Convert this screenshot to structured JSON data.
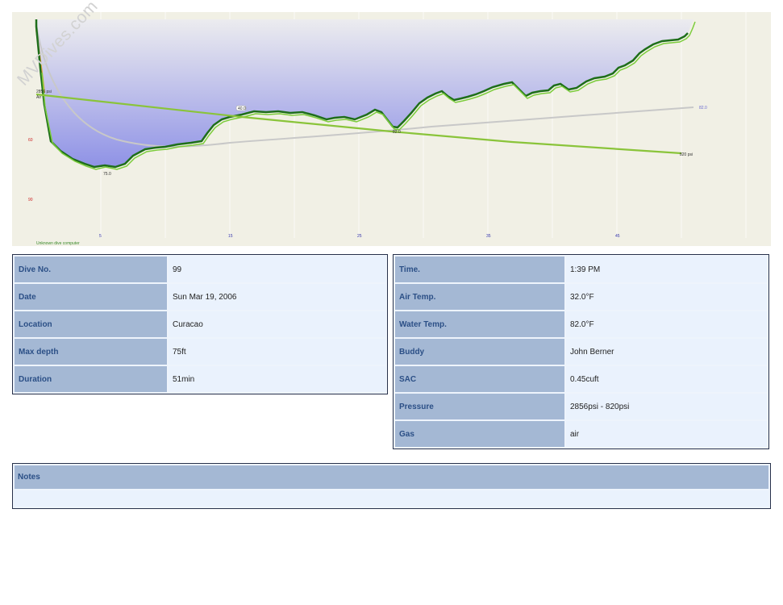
{
  "profile": {
    "watermark": "MVDives.com",
    "depth_ticks": [
      "60",
      "90"
    ],
    "time_ticks": [
      "5",
      "15",
      "25",
      "35",
      "45"
    ],
    "computer": "Unknown dive computer",
    "start_pressure": "2856 psi",
    "gas": "Air",
    "end_pressure": "820 psi",
    "max_depth_marker": "75.0",
    "temp_marker": "82.0",
    "cylinder_label": "40.0",
    "temp_end": "82.0",
    "colors": {
      "background": "#f1f0e5",
      "depth_line": "#1e6e1a",
      "pressure_line": "#8ac43a",
      "fill_top": "#e8e8ec",
      "fill_bottom": "#8f92e6",
      "temperature_line": "#c8c8c8"
    }
  },
  "dive_info": [
    {
      "label": "Dive No.",
      "value": "99"
    },
    {
      "label": "Date",
      "value": "Sun Mar 19, 2006"
    },
    {
      "label": "Location",
      "value": "Curacao"
    },
    {
      "label": "Max depth",
      "value": "75ft"
    },
    {
      "label": "Duration",
      "value": "51min"
    }
  ],
  "conditions": [
    {
      "label": "Time.",
      "value": "1:39 PM"
    },
    {
      "label": "Air Temp.",
      "value": "32.0°F"
    },
    {
      "label": "Water Temp.",
      "value": "82.0°F"
    },
    {
      "label": "Buddy",
      "value": "John Berner"
    },
    {
      "label": "SAC",
      "value": "0.45cuft"
    },
    {
      "label": "Pressure",
      "value": "2856psi - 820psi"
    },
    {
      "label": "Gas",
      "value": "air"
    }
  ],
  "notes": {
    "title": "Notes",
    "text": ""
  }
}
